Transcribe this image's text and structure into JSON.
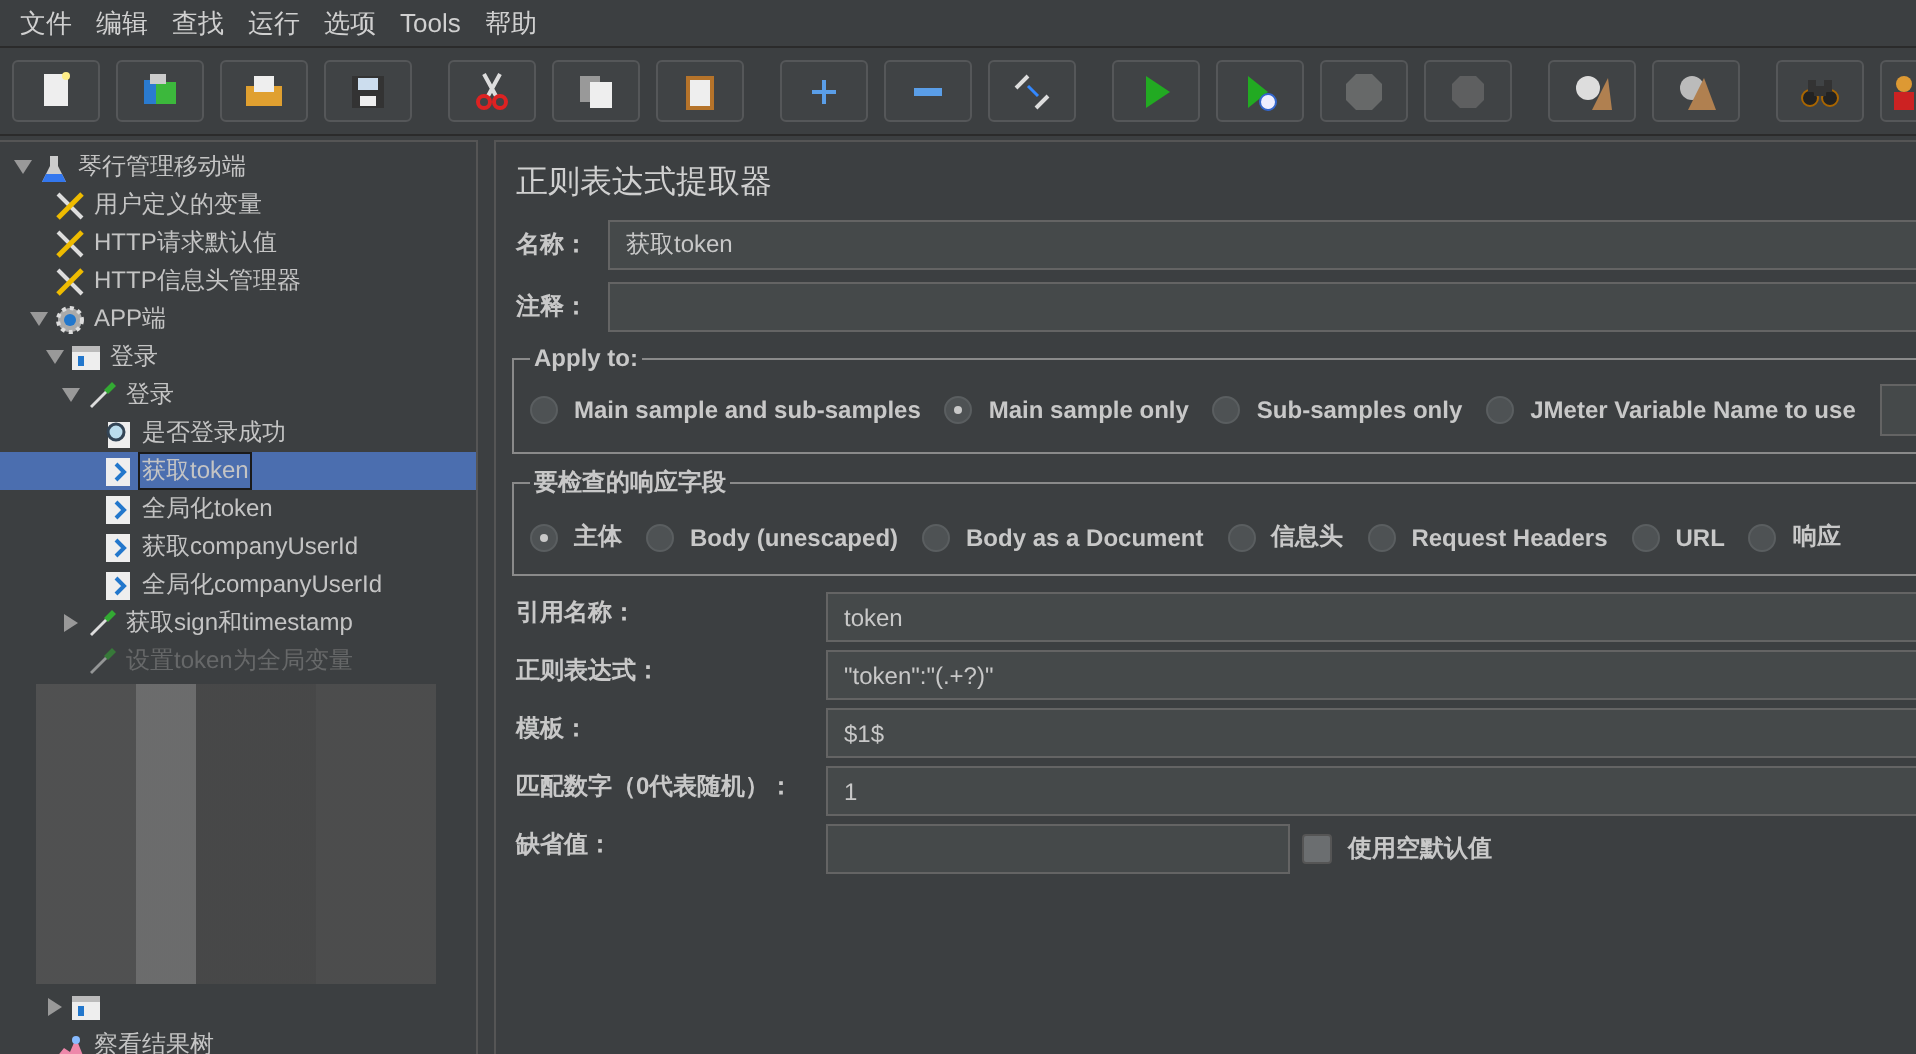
{
  "menu": [
    "文件",
    "编辑",
    "查找",
    "运行",
    "选项",
    "Tools",
    "帮助"
  ],
  "toolbar": [
    [
      {
        "kind": "new",
        "disabled": false
      },
      {
        "kind": "templates",
        "disabled": false
      },
      {
        "kind": "open",
        "disabled": false
      },
      {
        "kind": "save",
        "disabled": false
      }
    ],
    [
      {
        "kind": "cut",
        "disabled": false
      },
      {
        "kind": "copy",
        "disabled": false
      },
      {
        "kind": "paste",
        "disabled": false
      }
    ],
    [
      {
        "kind": "expand",
        "disabled": false
      },
      {
        "kind": "collapse",
        "disabled": false
      },
      {
        "kind": "toggle",
        "disabled": false
      }
    ],
    [
      {
        "kind": "start",
        "disabled": false
      },
      {
        "kind": "start-no-pause",
        "disabled": false
      },
      {
        "kind": "stop",
        "disabled": true
      },
      {
        "kind": "shutdown",
        "disabled": true
      }
    ],
    [
      {
        "kind": "clear",
        "disabled": false
      },
      {
        "kind": "clear-all",
        "disabled": false
      }
    ],
    [
      {
        "kind": "search",
        "disabled": false
      },
      {
        "kind": "reset",
        "disabled": false
      }
    ]
  ],
  "tree": [
    {
      "label": "琴行管理移动端",
      "kind": "plan",
      "expanded": true,
      "selected": false,
      "disabled": false,
      "children": [
        {
          "label": "用户定义的变量",
          "kind": "config",
          "selected": false,
          "disabled": false
        },
        {
          "label": "HTTP请求默认值",
          "kind": "config",
          "selected": false,
          "disabled": false
        },
        {
          "label": "HTTP信息头管理器",
          "kind": "config",
          "selected": false,
          "disabled": false
        },
        {
          "label": "APP端",
          "kind": "threadgroup",
          "expanded": true,
          "selected": false,
          "disabled": false,
          "children": [
            {
              "label": "登录",
              "kind": "controller",
              "expanded": true,
              "selected": false,
              "disabled": false,
              "children": [
                {
                  "label": "登录",
                  "kind": "sampler",
                  "expanded": true,
                  "selected": false,
                  "disabled": false,
                  "children": [
                    {
                      "label": "是否登录成功",
                      "kind": "assertion",
                      "selected": false,
                      "disabled": false
                    },
                    {
                      "label": "获取token",
                      "kind": "extractor",
                      "selected": true,
                      "disabled": false
                    },
                    {
                      "label": "全局化token",
                      "kind": "extractor",
                      "selected": false,
                      "disabled": false
                    },
                    {
                      "label": "获取companyUserId",
                      "kind": "extractor",
                      "selected": false,
                      "disabled": false
                    },
                    {
                      "label": "全局化companyUserId",
                      "kind": "extractor",
                      "selected": false,
                      "disabled": false
                    }
                  ]
                },
                {
                  "label": "获取sign和timestamp",
                  "kind": "sampler",
                  "expanded": false,
                  "selected": false,
                  "disabled": false
                },
                {
                  "label": "设置token为全局变量",
                  "kind": "sampler",
                  "selected": false,
                  "disabled": true
                }
              ]
            },
            {
              "kind": "redacted"
            },
            {
              "kind": "controller",
              "expanded": false,
              "selected": false,
              "disabled": false
            }
          ]
        },
        {
          "label": "察看结果树",
          "kind": "listener",
          "selected": false,
          "disabled": false
        }
      ]
    }
  ],
  "editor": {
    "title": "正则表达式提取器",
    "name": {
      "label": "名称：",
      "value": "获取token"
    },
    "comment": {
      "label": "注释："
    },
    "apply_to": {
      "legend": "Apply to:",
      "options": [
        {
          "label": "Main sample and sub-samples",
          "selected": false
        },
        {
          "label": "Main sample only",
          "selected": true
        },
        {
          "label": "Sub-samples only",
          "selected": false
        },
        {
          "label": "JMeter Variable Name to use",
          "selected": false
        }
      ]
    },
    "field_to_check": {
      "legend": "要检查的响应字段",
      "options": [
        {
          "label": "主体",
          "selected": true
        },
        {
          "label": "Body (unescaped)",
          "selected": false
        },
        {
          "label": "Body as a Document",
          "selected": false
        },
        {
          "label": "信息头",
          "selected": false
        },
        {
          "label": "Request Headers",
          "selected": false
        },
        {
          "label": "URL",
          "selected": false
        },
        {
          "label": "响应",
          "selected": false
        }
      ]
    },
    "fields": [
      {
        "label": "引用名称：",
        "value": "token"
      },
      {
        "label": "正则表达式：",
        "value": "\"token\":\"(.+?)\""
      },
      {
        "label": "模板：",
        "value": "$1$"
      },
      {
        "label": "匹配数字（0代表随机）：",
        "value": "1"
      }
    ],
    "default": {
      "label": "缺省值：",
      "checkbox": {
        "label": "使用空默认值",
        "checked": false
      }
    }
  }
}
